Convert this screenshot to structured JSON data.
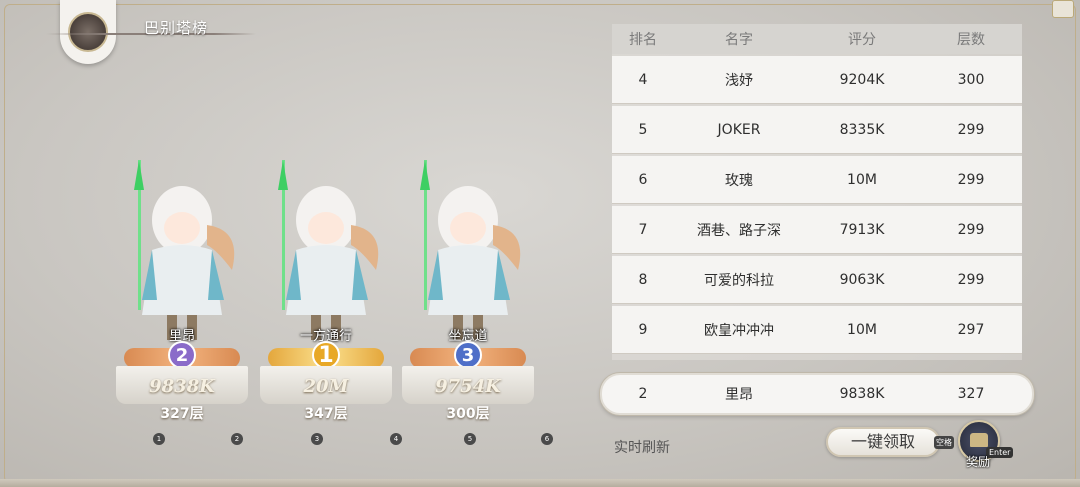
{
  "header": {
    "title": "巴别塔榜"
  },
  "podium": [
    {
      "name": "里昂",
      "rank": "2",
      "score": "9838K",
      "floor": "327层"
    },
    {
      "name": "一方通行",
      "rank": "1",
      "score": "20M",
      "floor": "347层"
    },
    {
      "name": "坐忘道",
      "rank": "3",
      "score": "9754K",
      "floor": "300层"
    }
  ],
  "pages": [
    "1",
    "2",
    "3",
    "4",
    "5",
    "6"
  ],
  "table": {
    "headers": [
      "排名",
      "名字",
      "评分",
      "层数"
    ],
    "rows": [
      {
        "rank": "4",
        "name": "浅妤",
        "score": "9204K",
        "floor": "300"
      },
      {
        "rank": "5",
        "name": "JOKER",
        "score": "8335K",
        "floor": "299"
      },
      {
        "rank": "6",
        "name": "玫瑰",
        "score": "10M",
        "floor": "299"
      },
      {
        "rank": "7",
        "name": "酒巷、路子深",
        "score": "7913K",
        "floor": "299"
      },
      {
        "rank": "8",
        "name": "可爱的科拉",
        "score": "9063K",
        "floor": "299"
      },
      {
        "rank": "9",
        "name": "欧皇冲冲冲",
        "score": "10M",
        "floor": "297"
      }
    ]
  },
  "my_rank": {
    "rank": "2",
    "name": "里昂",
    "score": "9838K",
    "floor": "327"
  },
  "footer": {
    "realtime": "实时刷新",
    "claim_label": "一键领取",
    "claim_key": "空格",
    "reward_label": "奖励",
    "reward_key": "Enter"
  },
  "icons": {
    "emblem": "tower-emblem-icon",
    "reward": "treasure-chest-icon"
  }
}
